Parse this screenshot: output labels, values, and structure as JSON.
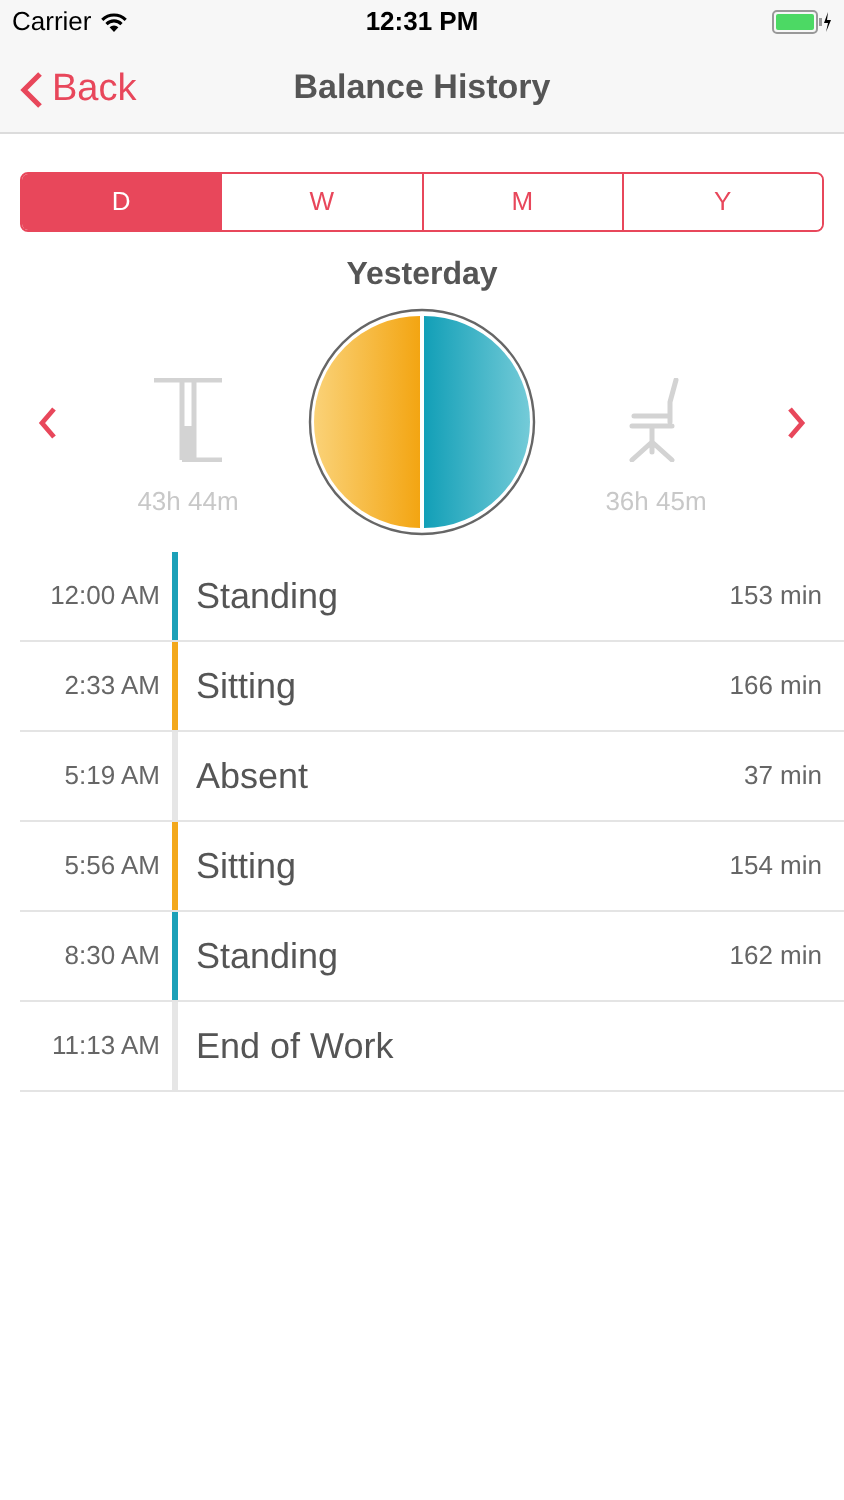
{
  "status_bar": {
    "carrier": "Carrier",
    "time": "12:31 PM"
  },
  "nav": {
    "back": "Back",
    "title": "Balance History"
  },
  "tabs": [
    {
      "label": "D",
      "selected": true
    },
    {
      "label": "W",
      "selected": false
    },
    {
      "label": "M",
      "selected": false
    },
    {
      "label": "Y",
      "selected": false
    }
  ],
  "period": "Yesterday",
  "summary": {
    "standing": "43h 44m",
    "sitting": "36h 45m"
  },
  "entries": [
    {
      "time": "12:00 AM",
      "activity": "Standing",
      "duration": "153 min",
      "color": "#1ba0b8"
    },
    {
      "time": "2:33 AM",
      "activity": "Sitting",
      "duration": "166 min",
      "color": "#f3a81b"
    },
    {
      "time": "5:19 AM",
      "activity": "Absent",
      "duration": "37 min",
      "color": "#e6e6e6"
    },
    {
      "time": "5:56 AM",
      "activity": "Sitting",
      "duration": "154 min",
      "color": "#f3a81b"
    },
    {
      "time": "8:30 AM",
      "activity": "Standing",
      "duration": "162 min",
      "color": "#1ba0b8"
    },
    {
      "time": "11:13 AM",
      "activity": "End of Work",
      "color": "#e6e6e6"
    }
  ]
}
